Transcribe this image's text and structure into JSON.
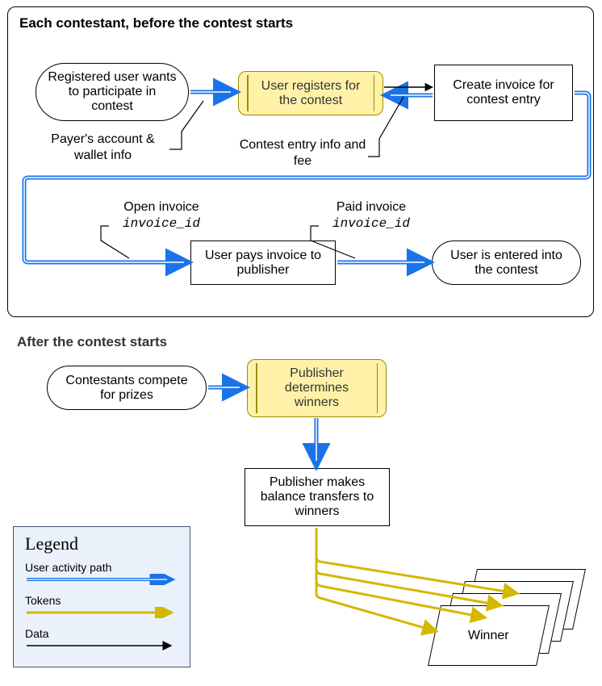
{
  "section1": {
    "title": "Each contestant, before the contest starts",
    "node_registered": "Registered user wants to participate in contest",
    "node_register_contest": "User registers for the contest",
    "node_create_invoice": "Create invoice for contest entry",
    "note_payer": "Payer's account & wallet info",
    "note_contest_entry": "Contest entry info and fee",
    "note_open_invoice_line1": "Open invoice",
    "note_open_invoice_line2": "invoice_id",
    "note_paid_invoice_line1": "Paid invoice",
    "note_paid_invoice_line2": "invoice_id",
    "node_user_pays": "User pays invoice to publisher",
    "node_user_entered": "User is entered into the contest"
  },
  "section2": {
    "title": "After the contest starts",
    "node_contestants": "Contestants compete for prizes",
    "node_publisher_determines": "Publisher determines winners",
    "node_balance_transfers": "Publisher makes balance transfers to winners",
    "node_winner": "Winner"
  },
  "legend": {
    "title": "Legend",
    "user_activity": "User activity path",
    "tokens": "Tokens",
    "data": "Data"
  },
  "colors": {
    "blue": "#1a73e8",
    "yellow_fill": "#fff2a8",
    "yellow_line": "#d4b800",
    "black": "#000000"
  }
}
